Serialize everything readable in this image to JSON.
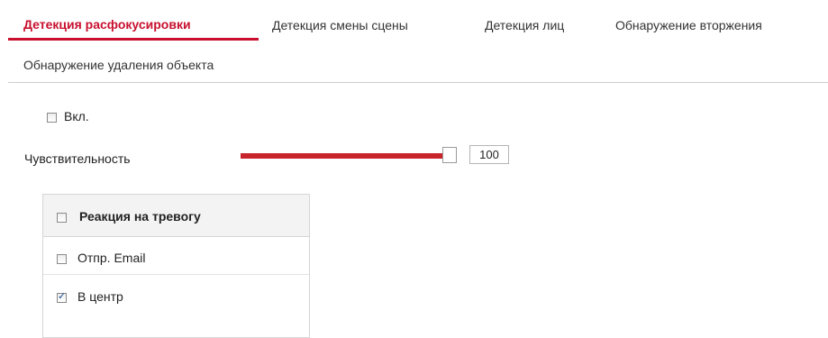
{
  "tabs": [
    {
      "label": "Детекция расфокусировки",
      "active": true
    },
    {
      "label": "Детекция смены сцены",
      "active": false
    },
    {
      "label": "Детекция лиц",
      "active": false
    },
    {
      "label": "Обнаружение вторжения",
      "active": false
    },
    {
      "label": "Обнаружение удаления объекта",
      "active": false
    }
  ],
  "enable": {
    "label": "Вкл.",
    "checked": false
  },
  "sensitivity": {
    "label": "Чувствительность",
    "value": "100",
    "min": 0,
    "max": 100
  },
  "alarm_panel": {
    "header": {
      "label": "Реакция на тревогу",
      "checked": false
    },
    "options": [
      {
        "label": "Отпр. Email",
        "checked": false
      },
      {
        "label": "В центр",
        "checked": true
      }
    ]
  },
  "colors": {
    "accent": "#c8102e",
    "slider_fill": "#c8242b"
  }
}
